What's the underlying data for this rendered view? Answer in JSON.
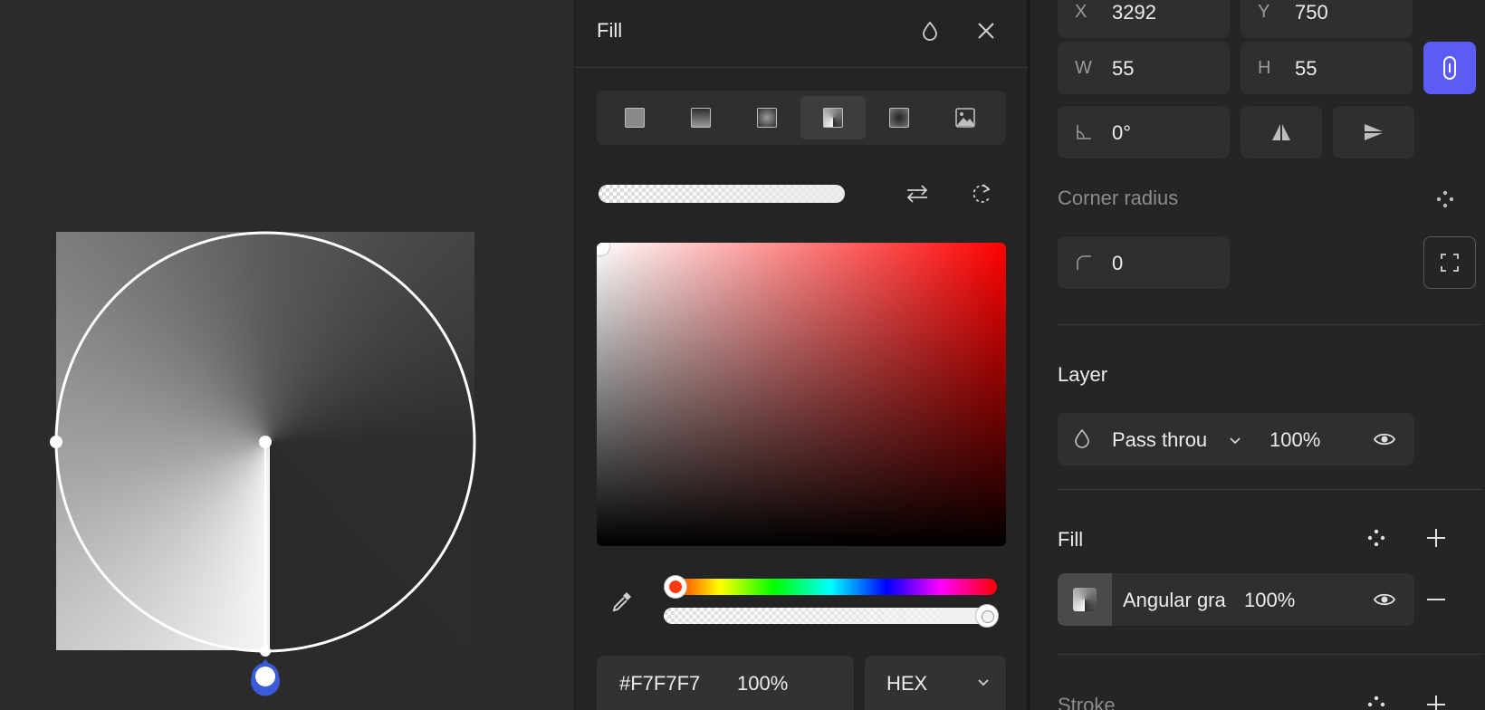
{
  "fill_popover": {
    "title": "Fill",
    "fill_types": [
      {
        "name": "solid",
        "icon": "solid-fill-icon"
      },
      {
        "name": "linear",
        "icon": "linear-gradient-icon"
      },
      {
        "name": "radial",
        "icon": "radial-gradient-icon"
      },
      {
        "name": "angular",
        "icon": "angular-gradient-icon",
        "active": true
      },
      {
        "name": "diamond",
        "icon": "diamond-gradient-icon"
      },
      {
        "name": "image",
        "icon": "image-fill-icon"
      }
    ],
    "picker_hue": "#ff0000",
    "hex_value": "#F7F7F7",
    "opacity": "100%",
    "color_mode": "HEX"
  },
  "properties": {
    "position": {
      "x_label": "X",
      "x_value": "3292",
      "y_label": "Y",
      "y_value": "750"
    },
    "size": {
      "w_label": "W",
      "w_value": "55",
      "h_label": "H",
      "h_value": "55"
    },
    "rotation_value": "0°",
    "corner_radius": {
      "title": "Corner radius",
      "value": "0"
    },
    "layer": {
      "title": "Layer",
      "blend_mode": "Pass throu",
      "opacity": "100%"
    },
    "fill": {
      "title": "Fill",
      "item_label": "Angular gra",
      "item_opacity": "100%"
    },
    "stroke": {
      "title": "Stroke"
    }
  },
  "colors": {
    "accent": "#5b5bf5",
    "panel_bg": "#252525",
    "canvas_bg": "#2b2b2b"
  }
}
